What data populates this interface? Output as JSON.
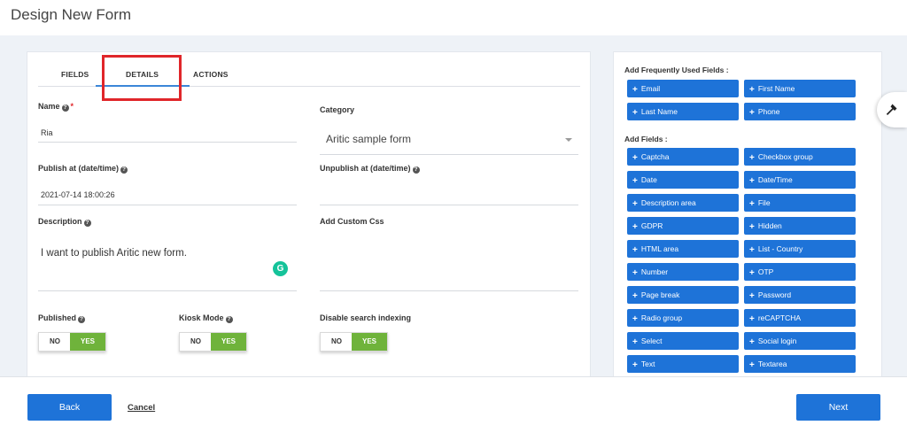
{
  "page": {
    "title": "Design New Form"
  },
  "tabs": [
    {
      "label": "FIELDS"
    },
    {
      "label": "DETAILS"
    },
    {
      "label": "ACTIONS"
    }
  ],
  "form": {
    "name": {
      "label": "Name",
      "value": "Ria"
    },
    "category": {
      "label": "Category",
      "value": "Aritic sample form"
    },
    "publish_at": {
      "label": "Publish at (date/time)",
      "value": "2021-07-14 18:00:26"
    },
    "unpublish_at": {
      "label": "Unpublish at (date/time)",
      "value": ""
    },
    "description": {
      "label": "Description",
      "value": "I want to publish Aritic new form."
    },
    "custom_css": {
      "label": "Add Custom Css",
      "value": ""
    },
    "published": {
      "label": "Published",
      "no": "NO",
      "yes": "YES"
    },
    "kiosk_mode": {
      "label": "Kiosk Mode",
      "no": "NO",
      "yes": "YES"
    },
    "disable_search_indexing": {
      "label": "Disable search indexing",
      "no": "NO",
      "yes": "YES"
    }
  },
  "sidebar": {
    "frequent_heading": "Add Frequently Used Fields :",
    "frequent_fields": [
      "Email",
      "First Name",
      "Last Name",
      "Phone"
    ],
    "fields_heading": "Add Fields :",
    "fields": [
      "Captcha",
      "Checkbox group",
      "Date",
      "Date/Time",
      "Description area",
      "File",
      "GDPR",
      "Hidden",
      "HTML area",
      "List - Country",
      "Number",
      "OTP",
      "Page break",
      "Password",
      "Radio group",
      "reCAPTCHA",
      "Select",
      "Social login",
      "Text",
      "Textarea"
    ]
  },
  "icons": {
    "help": "?",
    "plus": "+",
    "grammarly": "G",
    "floating_tool": "hammer-icon"
  },
  "footer": {
    "back_label": "Back",
    "cancel_label": "Cancel",
    "next_label": "Next"
  },
  "colors": {
    "primary": "#1e73d8",
    "toggle_yes": "#6fb33b",
    "highlight": "#e0262a",
    "tab_underline": "#3b86d8"
  }
}
